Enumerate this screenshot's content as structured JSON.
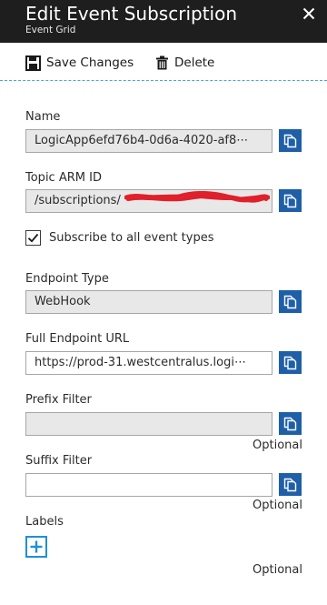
{
  "header": {
    "title": "Edit Event Subscription",
    "subtitle": "Event Grid",
    "close_icon": "close-icon"
  },
  "toolbar": {
    "save_label": "Save Changes",
    "save_icon": "save-icon",
    "delete_label": "Delete",
    "delete_icon": "trash-icon",
    "divider_color": "#4aa3df"
  },
  "fields": {
    "name": {
      "label": "Name",
      "value": "LogicApp6efd76b4-0d6a-4020-af8⋯"
    },
    "topic_arm_id": {
      "label": "Topic ARM ID",
      "value": "/subscriptions/"
    },
    "subscribe_all": {
      "label": "Subscribe to all event types",
      "checked": true
    },
    "endpoint_type": {
      "label": "Endpoint Type",
      "value": "WebHook"
    },
    "full_endpoint_url": {
      "label": "Full Endpoint URL",
      "value": "https://prod-31.westcentralus.logi⋯"
    },
    "prefix_filter": {
      "label": "Prefix Filter",
      "value": "",
      "note": "Optional"
    },
    "suffix_filter": {
      "label": "Suffix Filter",
      "value": "",
      "note": "Optional"
    },
    "labels": {
      "label": "Labels",
      "note": "Optional",
      "add_icon": "plus-icon"
    }
  },
  "colors": {
    "header_bg": "#1e1e1e",
    "copy_button": "#1f5fa8",
    "add_button_border": "#1f8fd6",
    "readonly_bg": "#e8e8e8",
    "redaction": "#e0202a"
  }
}
